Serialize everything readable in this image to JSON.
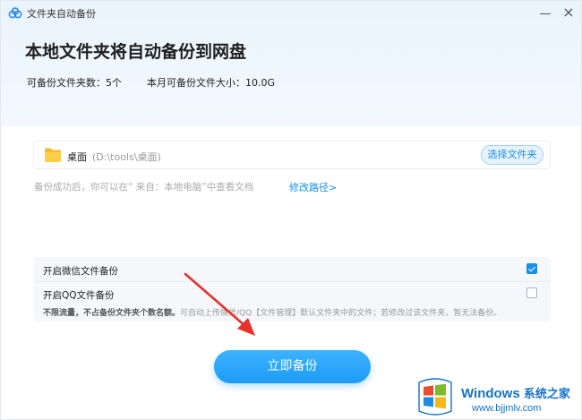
{
  "window": {
    "title": "文件夹自动备份",
    "close_glyph": "×"
  },
  "header": {
    "headline": "本地文件夹将自动备份到网盘",
    "folder_count_label": "可备份文件夹数：5个",
    "size_label": "本月可备份文件大小：10.0G"
  },
  "folder": {
    "name": "桌面",
    "path": "(D:\\tools\\桌面)",
    "choose_label": "选择文件夹",
    "icon": "folder-icon"
  },
  "hint": {
    "text": "备份成功后，你可以在“ 来自：本地电脑”中查看文档",
    "link": "修改路径>"
  },
  "options": {
    "wechat_label": "开启微信文件备份",
    "wechat_checked": true,
    "qq_label": "开启QQ文件备份",
    "qq_checked": false,
    "note_bold": "不限流量，不占备份文件夹个数名额。",
    "note_rest": "可自动上传微信/QQ【文件管理】默认文件夹中的文件；若修改过该文件夹，暂无法备份。"
  },
  "action": {
    "backup_label": "立即备份"
  },
  "watermark": {
    "title": "Windows",
    "title_cn": "系统之家",
    "url": "www.bjjmlv.com"
  },
  "colors": {
    "accent": "#1a8fe8",
    "arrow": "#e5322d",
    "header_bg": "#eaf4fd"
  }
}
